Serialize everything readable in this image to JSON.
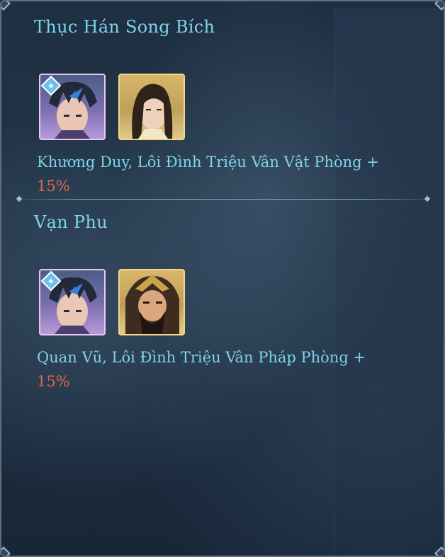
{
  "panel": {
    "accent": "#7fd3e6",
    "highlight": "#e0664a"
  },
  "bonds": [
    {
      "title": "Thục Hán Song Bích",
      "description": "Khương Duy, Lôi Đình Triệu Vân Vật Phòng +",
      "value": "15%",
      "heroes": [
        {
          "icon": "hero-portrait-loi-dinh-trieu-van",
          "frame": "purple",
          "badge": "awaken-badge-icon"
        },
        {
          "icon": "hero-portrait-khuong-duy",
          "frame": "gold"
        }
      ]
    },
    {
      "title": "Vạn Phu",
      "description": "Quan Vũ, Lôi Đình Triệu Vân Pháp Phòng +",
      "value": "15%",
      "heroes": [
        {
          "icon": "hero-portrait-loi-dinh-trieu-van",
          "frame": "purple",
          "badge": "awaken-badge-icon"
        },
        {
          "icon": "hero-portrait-quan-vu",
          "frame": "gold"
        }
      ]
    }
  ]
}
